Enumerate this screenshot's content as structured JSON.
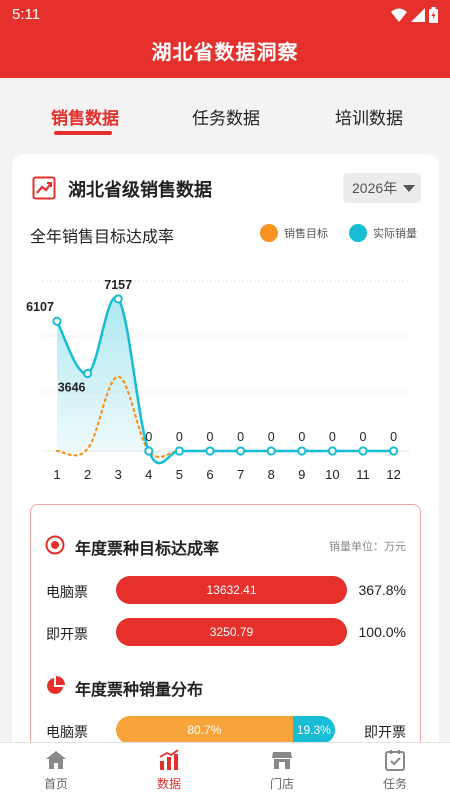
{
  "status_bar": {
    "time": "5:11"
  },
  "app_bar": {
    "title": "湖北省数据洞察"
  },
  "tabs": [
    {
      "label": "销售数据",
      "active": true
    },
    {
      "label": "任务数据",
      "active": false
    },
    {
      "label": "培训数据",
      "active": false
    }
  ],
  "card": {
    "title": "湖北省级销售数据",
    "year_select": "2026年",
    "chart_title": "全年销售目标达成率",
    "legend": [
      {
        "label": "销售目标",
        "color": "#f7931e"
      },
      {
        "label": "实际销量",
        "color": "#16bdd4"
      }
    ]
  },
  "chart_data": {
    "type": "line",
    "categories": [
      "1",
      "2",
      "3",
      "4",
      "5",
      "6",
      "7",
      "8",
      "9",
      "10",
      "11",
      "12"
    ],
    "series": [
      {
        "name": "销售目标",
        "color": "#f7931e",
        "style": "dotted",
        "values": [
          0,
          100,
          3500,
          0,
          0,
          0,
          0,
          0,
          0,
          0,
          0,
          0
        ]
      },
      {
        "name": "实际销量",
        "color": "#16bdd4",
        "style": "solid-area",
        "values": [
          6107,
          3646,
          7157,
          0,
          0,
          0,
          0,
          0,
          0,
          0,
          0,
          0
        ],
        "data_labels": [
          "6107",
          "3646",
          "7157",
          "0",
          "0",
          "0",
          "0",
          "0",
          "0",
          "0",
          "0",
          "0"
        ]
      }
    ],
    "ylim": [
      0,
      8000
    ],
    "grid": true
  },
  "ticket_section": {
    "title": "年度票种目标达成率",
    "unit": "销量单位：万元",
    "rows": [
      {
        "label": "电脑票",
        "value": "13632.41",
        "pct": "367.8%"
      },
      {
        "label": "即开票",
        "value": "3250.79",
        "pct": "100.0%"
      }
    ]
  },
  "distribution_section": {
    "title": "年度票种销量分布",
    "left_label": "电脑票",
    "right_label": "即开票",
    "left_pct": "80.7%",
    "right_pct": "19.3%",
    "left_share": 0.807,
    "colors": {
      "left": "#f7a43a",
      "right": "#16bdd4"
    }
  },
  "bottom_nav": [
    {
      "label": "首页",
      "icon": "home-icon",
      "active": false
    },
    {
      "label": "数据",
      "icon": "data-icon",
      "active": true
    },
    {
      "label": "门店",
      "icon": "store-icon",
      "active": false
    },
    {
      "label": "任务",
      "icon": "task-icon",
      "active": false
    }
  ],
  "colors": {
    "brand": "#e5302b"
  }
}
